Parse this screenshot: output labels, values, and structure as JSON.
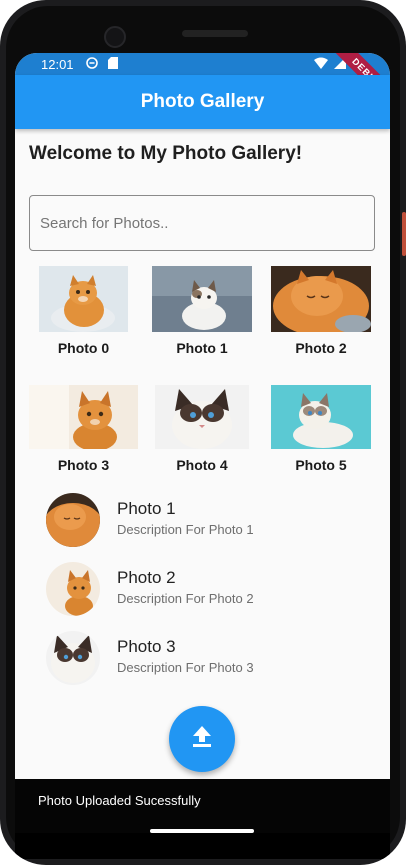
{
  "status_bar": {
    "time": "12:01",
    "debug_label": "DEBUG"
  },
  "app_bar": {
    "title": "Photo Gallery"
  },
  "welcome": "Welcome to My Photo Gallery!",
  "search": {
    "placeholder": "Search for Photos.."
  },
  "grid": [
    {
      "caption": "Photo 0",
      "icon": "orange-cat-photo"
    },
    {
      "caption": "Photo 1",
      "icon": "white-kitten-photo"
    },
    {
      "caption": "Photo 2",
      "icon": "sleeping-cat-photo"
    },
    {
      "caption": "Photo 3",
      "icon": "orange-cat-photo"
    },
    {
      "caption": "Photo 4",
      "icon": "ragdoll-cat-photo"
    },
    {
      "caption": "Photo 5",
      "icon": "ragdoll-lying-photo"
    }
  ],
  "list": [
    {
      "title": "Photo 1",
      "description": "Description For Photo 1"
    },
    {
      "title": "Photo 2",
      "description": "Description For Photo 2"
    },
    {
      "title": "Photo 3",
      "description": "Description For Photo 3"
    }
  ],
  "fab": {
    "icon": "upload-icon"
  },
  "snackbar": {
    "message": "Photo Uploaded Sucessfully"
  },
  "colors": {
    "primary": "#2196f3",
    "status_bar": "#1e7fd0",
    "debug_banner": "#b01e44"
  }
}
